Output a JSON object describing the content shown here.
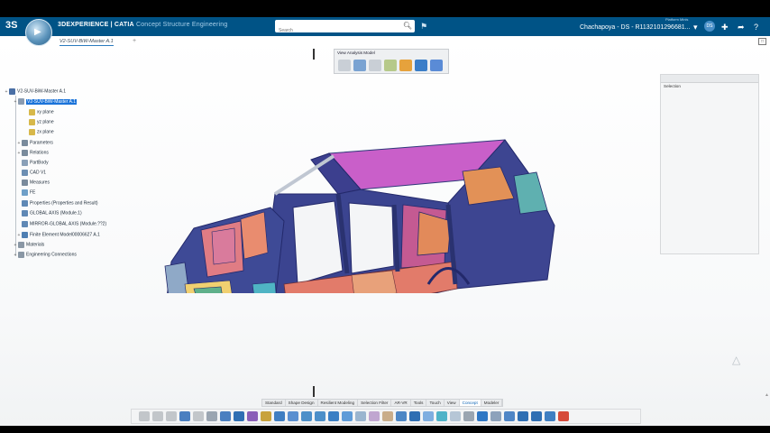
{
  "header": {
    "ds_logo": "3S",
    "compass_label": "▶",
    "brand_main": "3DEXPERIENCE | CATIA",
    "brand_sub": "Concept Structure Engineering",
    "search_placeholder": "Search",
    "user_small": "Platform Minis",
    "user": "Chachapoya - DS - R1132101296681...",
    "avatar_initials": "DS"
  },
  "tab": {
    "title": "V2-SUV-BiW-Master A.1",
    "plus": "+"
  },
  "view_analysis": {
    "title": "View Analysis Model",
    "icon_colors": [
      "#c9cfd6",
      "#7aa3d2",
      "#c9cfd6",
      "#b6c98a",
      "#e6a23c",
      "#3b7ec8",
      "#5a8bd6"
    ]
  },
  "selection_panel": {
    "title": "Selection"
  },
  "tree": [
    {
      "label": "V2-SUV-BiW-Master A.1",
      "color": "#4a6fa5"
    },
    {
      "label": "V2-SUV-BiW-Master A.1",
      "color": "#8a9bb0",
      "selected": true
    },
    {
      "label": "xy plane",
      "color": "#d7b84a"
    },
    {
      "label": "yz plane",
      "color": "#d7b84a"
    },
    {
      "label": "zx plane",
      "color": "#d7b84a"
    },
    {
      "label": "Parameters",
      "color": "#7a8b9c"
    },
    {
      "label": "Relations",
      "color": "#7a8b9c"
    },
    {
      "label": "PartBody",
      "color": "#8aa0b8"
    },
    {
      "label": "CAD V1",
      "color": "#6d8fb3"
    },
    {
      "label": "Measures",
      "color": "#7a8b9c"
    },
    {
      "label": "FE",
      "color": "#6fa0c8"
    },
    {
      "label": "Properties (Properties and Result)",
      "color": "#5f88b5"
    },
    {
      "label": "GLOBAL AXIS (Module.1)",
      "color": "#5f88b5"
    },
    {
      "label": "MIRROR-GLOBAL AXIS (Module.??2)",
      "color": "#5f88b5"
    },
    {
      "label": "Finite Element Model00006627 A.1",
      "color": "#4f7fb3"
    },
    {
      "label": "Materials",
      "color": "#8a97a5"
    },
    {
      "label": "Engineering Connections",
      "color": "#8a97a5"
    }
  ],
  "module_tabs": [
    "Standard",
    "Shape Design",
    "Resilient Modeling",
    "Selection Filter",
    "AR-VR",
    "Tools",
    "Touch",
    "View",
    "Concept",
    "Modeler"
  ],
  "active_module_tab": "Concept",
  "action_icon_colors": [
    "#c2c6ca",
    "#c2c6ca",
    "#c2c6ca",
    "#4a7fc0",
    "#c2c6ca",
    "#9aa5b1",
    "#4a7fc0",
    "#2f6fb3",
    "#8a5fb8",
    "#c8a23c",
    "#3f7ec2",
    "#5a8fd0",
    "#4c8fc9",
    "#4c8fc9",
    "#3b7fc4",
    "#5e9bd8",
    "#9ab5cf",
    "#c0a6d0",
    "#c9ad8a",
    "#4d87c5",
    "#2f6fb3",
    "#7faee0",
    "#4fb3c8",
    "#b6c6d6",
    "#9aa5b1",
    "#2f77c4",
    "#8da2bb",
    "#4f86c6",
    "#2f6fb3",
    "#2f6fb3",
    "#3f7fc2",
    "#d64b3a"
  ]
}
